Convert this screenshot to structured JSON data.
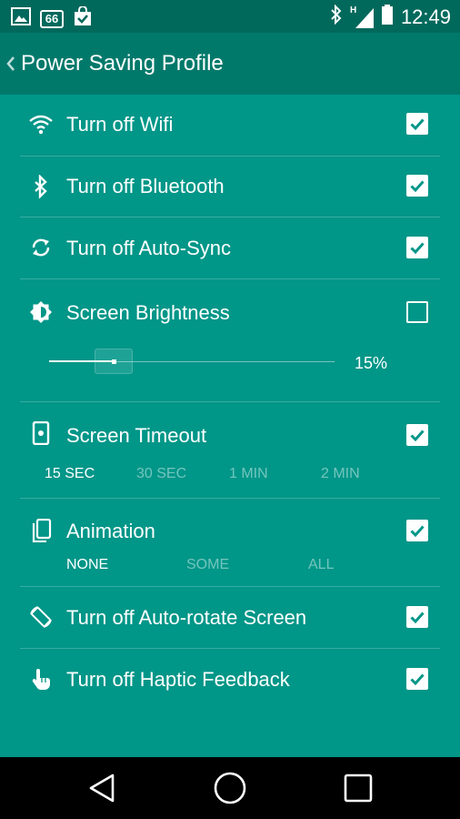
{
  "status_bar": {
    "badge_text": "66",
    "network_label": "H",
    "time": "12:49"
  },
  "header": {
    "title": "Power Saving Profile"
  },
  "settings": [
    {
      "label": "Turn off Wifi",
      "checked": true,
      "icon": "wifi-icon"
    },
    {
      "label": "Turn off Bluetooth",
      "checked": true,
      "icon": "bluetooth-icon"
    },
    {
      "label": "Turn off Auto-Sync",
      "checked": true,
      "icon": "sync-icon"
    },
    {
      "label": "Screen Brightness",
      "checked": false,
      "icon": "brightness-icon"
    },
    {
      "label": "Screen Timeout",
      "checked": true,
      "icon": "screen-timeout-icon"
    },
    {
      "label": "Animation",
      "checked": true,
      "icon": "animation-icon"
    },
    {
      "label": "Turn off Auto-rotate Screen",
      "checked": true,
      "icon": "rotate-icon"
    },
    {
      "label": "Turn off Haptic Feedback",
      "checked": true,
      "icon": "touch-icon"
    }
  ],
  "brightness": {
    "level_percent": 15,
    "label": "15%"
  },
  "timeout_options": [
    "15 SEC",
    "30 SEC",
    "1 MIN",
    "2 MIN"
  ],
  "timeout_selected": "15 SEC",
  "animation_options": [
    "NONE",
    "SOME",
    "ALL"
  ],
  "animation_selected": "NONE",
  "colors": {
    "background": "#009688",
    "app_bar": "#00796b",
    "status_bar": "#00695c",
    "checkmark": "#009688"
  }
}
